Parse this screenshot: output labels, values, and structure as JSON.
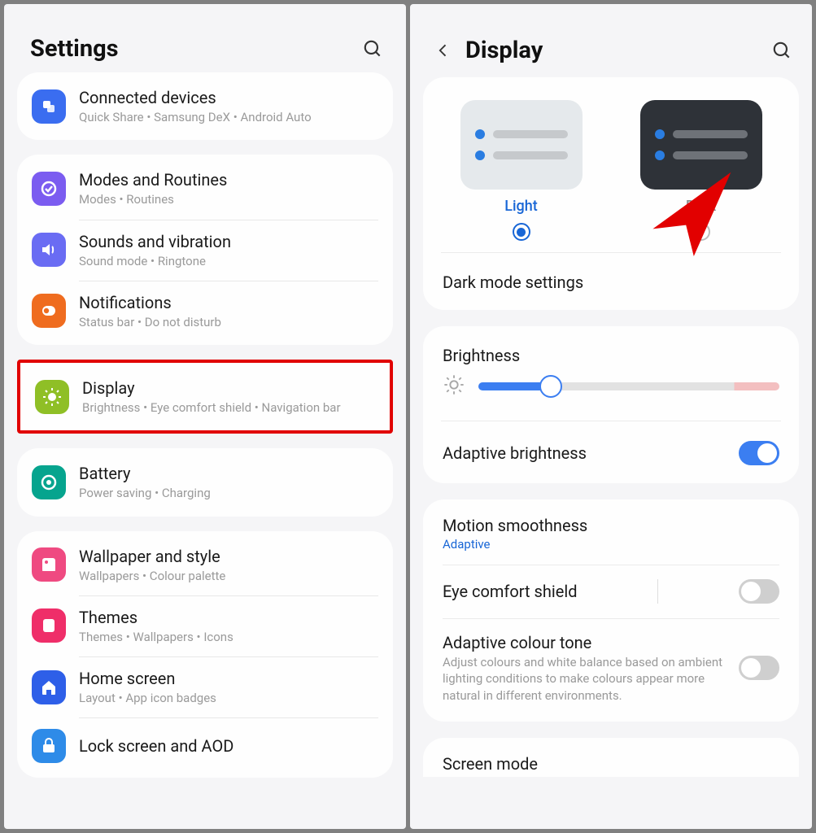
{
  "left": {
    "title": "Settings",
    "groups": [
      {
        "rows": [
          {
            "icon": "connected",
            "color": "ic-blue",
            "title": "Connected devices",
            "sub": "Quick Share  •  Samsung DeX  •  Android Auto"
          }
        ]
      },
      {
        "rows": [
          {
            "icon": "modes",
            "color": "ic-purple",
            "title": "Modes and Routines",
            "sub": "Modes  •  Routines"
          },
          {
            "icon": "sound",
            "color": "ic-sound",
            "title": "Sounds and vibration",
            "sub": "Sound mode  •  Ringtone"
          },
          {
            "icon": "notif",
            "color": "ic-orange",
            "title": "Notifications",
            "sub": "Status bar  •  Do not disturb"
          }
        ]
      },
      {
        "highlight": true,
        "rows": [
          {
            "icon": "display",
            "color": "ic-green",
            "title": "Display",
            "sub": "Brightness  •  Eye comfort shield  •  Navigation bar"
          }
        ]
      },
      {
        "rows": [
          {
            "icon": "battery",
            "color": "ic-teal",
            "title": "Battery",
            "sub": "Power saving  •  Charging"
          }
        ]
      },
      {
        "rows": [
          {
            "icon": "wallpaper",
            "color": "ic-pink",
            "title": "Wallpaper and style",
            "sub": "Wallpapers  •  Colour palette"
          },
          {
            "icon": "themes",
            "color": "ic-magenta",
            "title": "Themes",
            "sub": "Themes  •  Wallpapers  •  Icons"
          },
          {
            "icon": "home",
            "color": "ic-navy",
            "title": "Home screen",
            "sub": "Layout  •  App icon badges"
          },
          {
            "icon": "lock",
            "color": "ic-blue2",
            "title": "Lock screen and AOD",
            "sub": ""
          }
        ]
      }
    ]
  },
  "right": {
    "title": "Display",
    "theme": {
      "light_label": "Light",
      "dark_label": "Dark",
      "selected": "light",
      "settings_label": "Dark mode settings"
    },
    "brightness": {
      "label": "Brightness",
      "value_pct": 24
    },
    "adaptive_brightness": {
      "label": "Adaptive brightness",
      "on": true
    },
    "motion": {
      "label": "Motion smoothness",
      "value": "Adaptive"
    },
    "eye_comfort": {
      "label": "Eye comfort shield",
      "on": false
    },
    "adaptive_colour": {
      "label": "Adaptive colour tone",
      "sub": "Adjust colours and white balance based on ambient lighting conditions to make colours appear more natural in different environments.",
      "on": false
    },
    "screen_mode": "Screen mode"
  }
}
